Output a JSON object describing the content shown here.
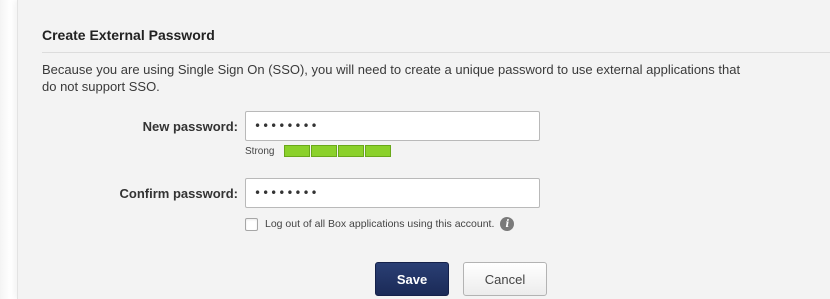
{
  "title": "Create External Password",
  "description": [
    "Because you are using Single Sign On (SSO), you will need to create a unique password to use external applications that",
    "do not support SSO."
  ],
  "new_password": {
    "label": "New password:",
    "value": "••••••••"
  },
  "strength": {
    "label": "Strong",
    "level": 1.0,
    "segments": 4,
    "color": "#8bd12b"
  },
  "confirm_password": {
    "label": "Confirm password:",
    "value": "••••••••"
  },
  "logout_checkbox": {
    "label": "Log out of all Box applications using this account.",
    "checked": false,
    "info_icon": "info-icon"
  },
  "buttons": {
    "save": "Save",
    "cancel": "Cancel",
    "save_color": "#1f3060"
  }
}
